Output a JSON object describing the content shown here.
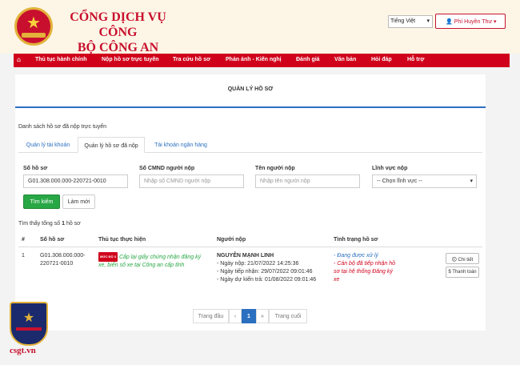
{
  "header": {
    "title_line1": "CỔNG DỊCH VỤ CÔNG",
    "title_line2": "BỘ CÔNG AN",
    "language": "Tiếng Việt",
    "user_name": "Phí Huyền Thư"
  },
  "nav": {
    "items": [
      "Thủ tục hành chính",
      "Nộp hồ sơ trực tuyến",
      "Tra cứu hồ sơ",
      "Phản ánh - Kiến nghị",
      "Đánh giá",
      "Văn bản",
      "Hỏi đáp",
      "Hỗ trợ"
    ]
  },
  "page": {
    "title": "QUẢN LÝ HỒ SƠ",
    "section_label": "Danh sách hồ sơ đã nộp trực tuyến",
    "tabs": [
      "Quản lý tài khoản",
      "Quản lý hồ sơ đã nộp",
      "Tài khoản ngân hàng"
    ]
  },
  "filters": {
    "so_ho_so": {
      "label": "Số hồ sơ",
      "value": "G01.308.000.000-220721-0010"
    },
    "cmnd": {
      "label": "Số CMND người nộp",
      "placeholder": "Nhập số CMND người nộp"
    },
    "ten": {
      "label": "Tên người nộp",
      "placeholder": "Nhập tên người nộp"
    },
    "linh_vuc": {
      "label": "Lĩnh vực nộp",
      "value": "-- Chọn lĩnh vực --"
    },
    "search_label": "Tìm kiếm",
    "reset_label": "Làm mới"
  },
  "results": {
    "prefix": "Tìm thấy tổng số ",
    "count": "1",
    "suffix": " hồ sơ",
    "columns": [
      "#",
      "Số hồ sơ",
      "Thủ tục thực hiện",
      "Người nộp",
      "Tình trạng hồ sơ"
    ],
    "rows": [
      {
        "index": "1",
        "so_ho_so_1": "G01.308.000.000-",
        "so_ho_so_2": "220721-0010",
        "badge": "MỨC ĐỘ 3",
        "thu_tuc_1": "Cấp lại giấy chứng nhận đăng ký",
        "thu_tuc_2": "xe, biển số xe tại Công an cấp tỉnh",
        "nguoi_nop": "NGUYỄN MẠNH LINH",
        "ngay_nop": "- Ngày nộp: 21/07/2022 14:25:36",
        "ngay_tiep_nhan": "- Ngày tiếp nhận: 29/07/2022 09:01:46",
        "ngay_du_kien": "- Ngày dự kiến trả: 01/08/2022 09:01:46",
        "status_1": "- Đang được xử lý",
        "status_2": "- Cán bộ đã tiếp nhận hồ",
        "status_3": "sơ tại hệ thống Đăng ký",
        "status_4": "xe",
        "detail_label": "Chi tiết",
        "pay_label": "Thanh toán"
      }
    ]
  },
  "pagination": {
    "first": "Trang đầu",
    "prev": "‹",
    "current": "1",
    "next": "»",
    "last": "Trang cuối"
  },
  "watermark": {
    "shield_text": "CSGT",
    "site": "csgt.vn"
  },
  "colors": {
    "brand_red": "#d0021b",
    "accent_blue": "#2b6fc0",
    "success_green": "#28a745"
  },
  "icons": {
    "home": "home-icon",
    "user": "user-icon",
    "detail": "info-icon",
    "pay": "dollar-icon"
  }
}
